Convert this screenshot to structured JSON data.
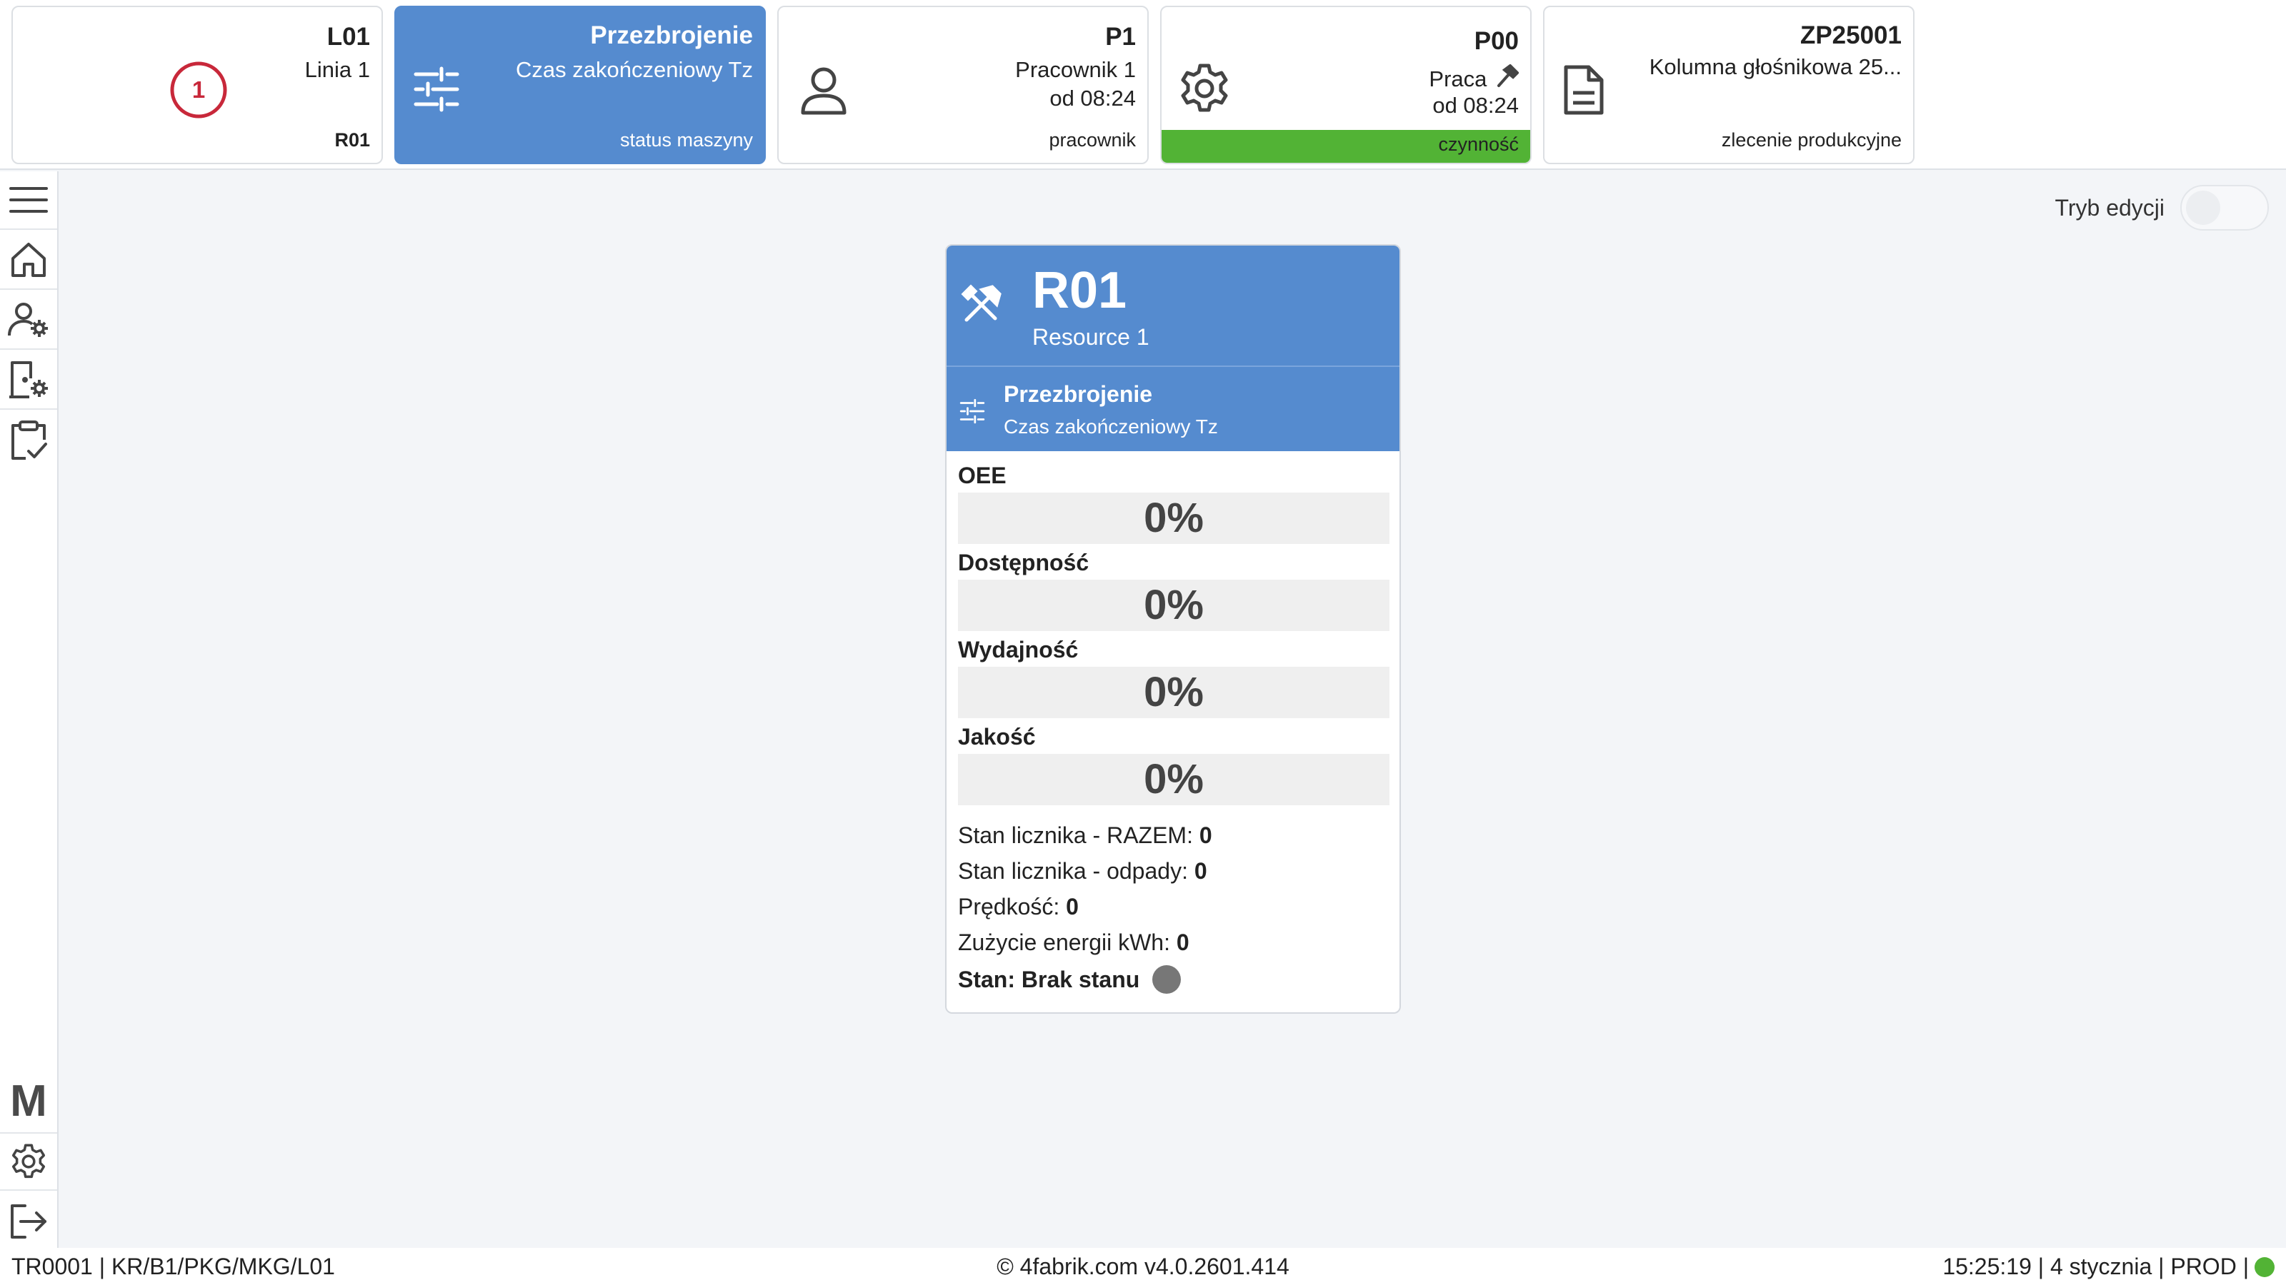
{
  "header": {
    "line_tile": {
      "code": "L01",
      "name": "Linia 1",
      "footer": "R01",
      "badge_count": "1"
    },
    "status_tile": {
      "title": "Przezbrojenie",
      "subtitle": "Czas zakończeniowy Tz",
      "footer": "status maszyny"
    },
    "worker_tile": {
      "code": "P1",
      "name": "Pracownik 1",
      "since": "od 08:24",
      "footer": "pracownik"
    },
    "activity_tile": {
      "code": "P00",
      "name": "Praca",
      "since": "od 08:24",
      "footer": "czynność",
      "status_color": "#52b335"
    },
    "order_tile": {
      "code": "ZP25001",
      "name": "Kolumna głośnikowa 25...",
      "footer": "zlecenie produkcyjne"
    }
  },
  "sidebar": {
    "items": [
      {
        "icon": "menu-icon"
      },
      {
        "icon": "home-icon"
      },
      {
        "icon": "user-settings-icon"
      },
      {
        "icon": "door-settings-icon"
      },
      {
        "icon": "clipboard-check-icon"
      }
    ],
    "bottom": {
      "logo": "M",
      "settings_icon": "gear-icon",
      "logout_icon": "logout-icon"
    }
  },
  "edit_mode": {
    "label": "Tryb edycji",
    "enabled": false
  },
  "resource_card": {
    "code": "R01",
    "name": "Resource 1",
    "status_title": "Przezbrojenie",
    "status_subtitle": "Czas zakończeniowy Tz",
    "metrics": [
      {
        "label": "OEE",
        "value": "0%"
      },
      {
        "label": "Dostępność",
        "value": "0%"
      },
      {
        "label": "Wydajność",
        "value": "0%"
      },
      {
        "label": "Jakość",
        "value": "0%"
      }
    ],
    "stats": [
      {
        "label": "Stan licznika - RAZEM:",
        "value": "0"
      },
      {
        "label": "Stan licznika - odpady:",
        "value": "0"
      },
      {
        "label": "Prędkość:",
        "value": "0"
      },
      {
        "label": "Zużycie energii kWh:",
        "value": "0"
      }
    ],
    "state_label": "Stan: Brak stanu",
    "state_color": "#777777"
  },
  "footer": {
    "left": "TR0001 | KR/B1/PKG/MKG/L01",
    "center": "© 4fabrik.com v4.0.2601.414",
    "right": "15:25:19 | 4 stycznia | PROD |",
    "connection_color": "#52b335"
  },
  "colors": {
    "accent": "#558bcf",
    "ok": "#52b335",
    "alert": "#c8283a"
  }
}
